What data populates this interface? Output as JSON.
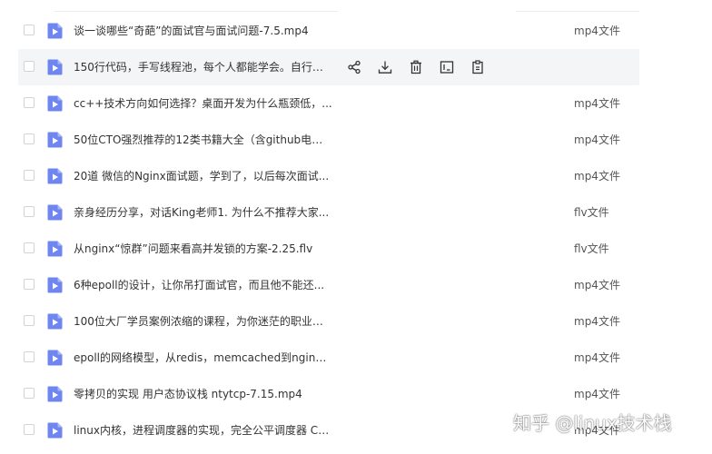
{
  "colors": {
    "file_icon": "#6f86f0",
    "hover_row_bg": "#f4f5f7",
    "text": "#333333",
    "type_text": "#555555"
  },
  "files": [
    {
      "name": "谈一谈哪些“奇葩”的面试官与面试问题-7.5.mp4",
      "type": "mp4文件"
    },
    {
      "name": "150行代码，手写线程池，每个人都能学会。自行准...",
      "type": ""
    },
    {
      "name": "cc++技术方向如何选择？桌面开发为什么瓶颈低，...",
      "type": "mp4文件"
    },
    {
      "name": "50位CTO强烈推荐的12类书籍大全（含github电子...",
      "type": "mp4文件"
    },
    {
      "name": "20道 微信的Nginx面试题，学到了，以后每次面试...",
      "type": "mp4文件"
    },
    {
      "name": "亲身经历分享，对话King老师1. 为什么不推荐大家...",
      "type": "flv文件"
    },
    {
      "name": "从nginx“惊群”问题来看高并发锁的方案-2.25.flv",
      "type": "flv文件"
    },
    {
      "name": "6种epoll的设计，让你吊打面试官，而且他不能还...",
      "type": "mp4文件"
    },
    {
      "name": "100位大厂学员案例浓缩的课程，为你迷茫的职业点...",
      "type": "mp4文件"
    },
    {
      "name": "epoll的网络模型，从redis，memcached到nginx-...",
      "type": "mp4文件"
    },
    {
      "name": "零拷贝的实现 用户态协议栈 ntytcp-7.15.mp4",
      "type": "mp4文件"
    },
    {
      "name": "linux内核，进程调度器的实现，完全公平调度器 CF...",
      "type": "mp4文件"
    }
  ],
  "hover_actions": [
    {
      "icon": "share-icon"
    },
    {
      "icon": "download-icon"
    },
    {
      "icon": "delete-icon"
    },
    {
      "icon": "rename-icon"
    },
    {
      "icon": "copy-icon"
    }
  ],
  "watermark": "知乎 @linux技术栈"
}
